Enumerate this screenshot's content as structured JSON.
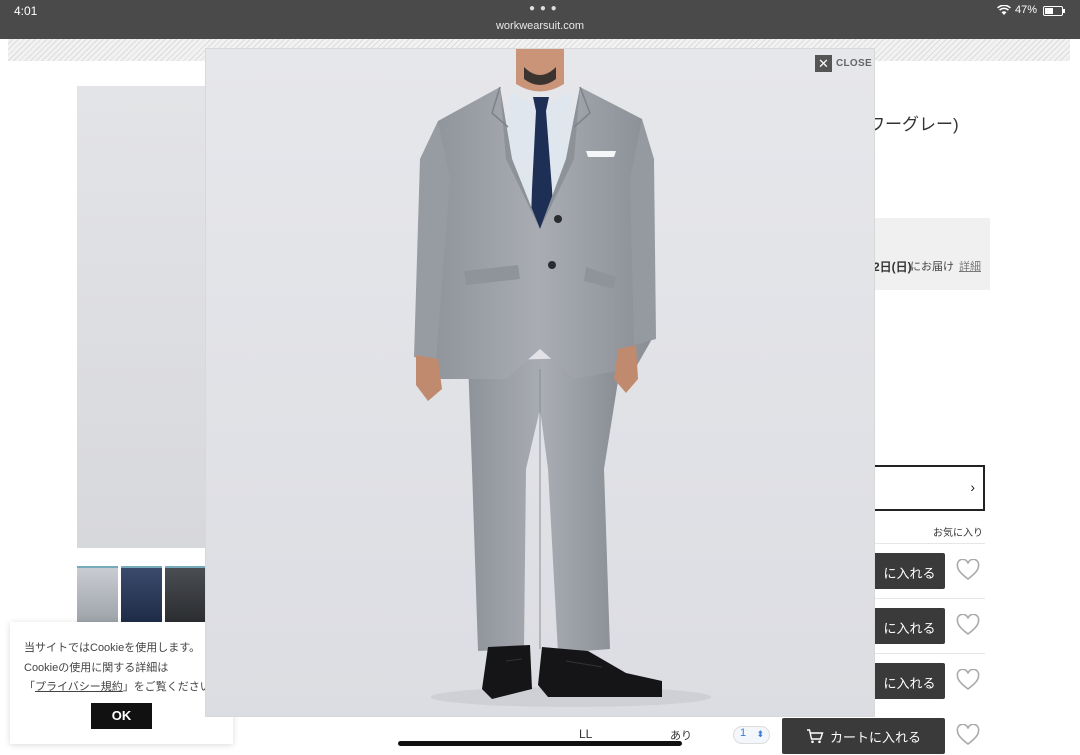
{
  "status_bar": {
    "time": "4:01",
    "url": "workwearsuit.com",
    "battery": "47%"
  },
  "product": {
    "title_fragment": "ワーグレー)",
    "delivery_date": "2日(日)",
    "delivery_text": "にお届け",
    "delivery_link": "詳細",
    "favorite_header": "お気に入り",
    "cart_fragment": "に入れる"
  },
  "bottom_row": {
    "size": "LL",
    "stock": "あり",
    "qty": "1",
    "cart_label": "カートに入れる"
  },
  "cookie": {
    "line1": "当サイトではCookieを使用します。",
    "line2": "Cookieの使用に関する詳細は",
    "line3_open": "「",
    "policy_link": "プライバシー規約",
    "line3_close": "」をご覧ください。",
    "ok_label": "OK"
  },
  "lightbox": {
    "close_label": "CLOSE"
  },
  "colors": {
    "statusbar": "#4a4a4a",
    "cart_button": "#3a3a3a",
    "suit_gray": "#9fa4aa",
    "tie_navy": "#1e2f55"
  }
}
